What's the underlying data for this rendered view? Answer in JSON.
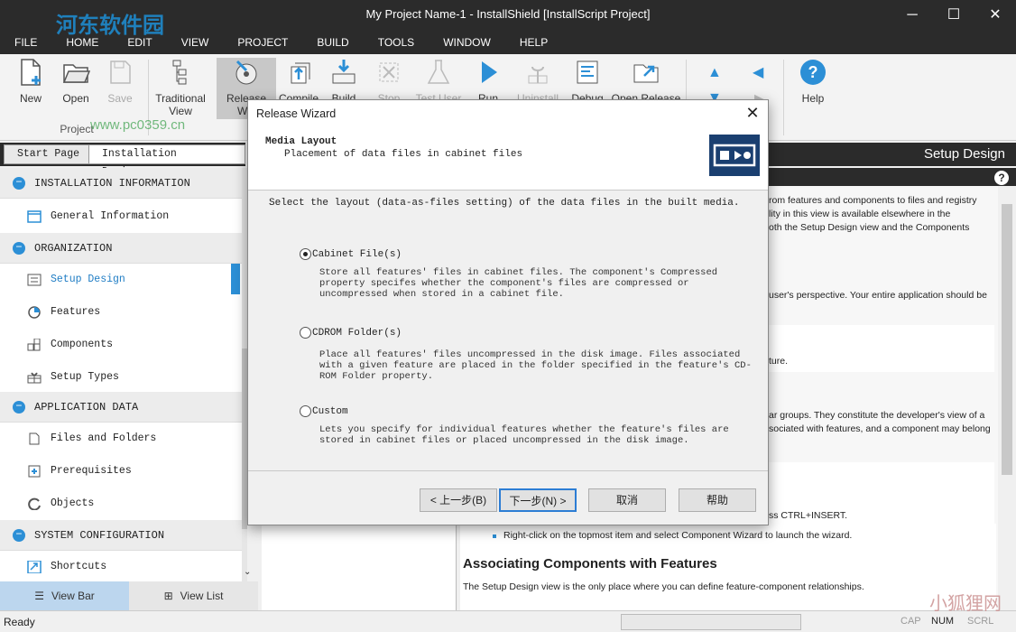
{
  "window": {
    "title": "My Project Name-1 - InstallShield [InstallScript Project]",
    "minimize": "─",
    "maximize": "☐",
    "close": "✕"
  },
  "watermark": {
    "site": "河东软件园",
    "url": "www.pc0359.cn",
    "site2": "小狐狸网",
    "url2": "XHLKS.CN"
  },
  "menu": [
    "FILE",
    "HOME",
    "EDIT",
    "VIEW",
    "PROJECT",
    "BUILD",
    "TOOLS",
    "WINDOW",
    "HELP"
  ],
  "ribbon": {
    "project": {
      "new": "New",
      "open": "Open",
      "save": "Save",
      "group": "Project"
    },
    "traditional": "Traditional View",
    "release": "Release Wiz",
    "compile": "Compile",
    "build": "Build",
    "stop": "Stop",
    "test_user": "Test User",
    "run": "Run",
    "uninstall": "Uninstall",
    "debug": "Debug",
    "open_release": "Open Release",
    "help": "Help"
  },
  "tabs": {
    "start": "Start Page",
    "designer": "Installation Designer"
  },
  "nav": {
    "sec1": "INSTALLATION INFORMATION",
    "general": "General Information",
    "sec2": "ORGANIZATION",
    "setup_design": "Setup Design",
    "features": "Features",
    "components": "Components",
    "setup_types": "Setup Types",
    "sec3": "APPLICATION DATA",
    "files": "Files and Folders",
    "prereq": "Prerequisites",
    "objects": "Objects",
    "sec4": "SYSTEM CONFIGURATION",
    "shortcuts": "Shortcuts"
  },
  "viewbar": {
    "viewbar": "View Bar",
    "viewlist": "View List"
  },
  "status": {
    "ready": "Ready",
    "cap": "CAP",
    "num": "NUM",
    "scrl": "SCRL"
  },
  "right": {
    "header": "Setup Design",
    "lines": [
      "rom features and components to files and registry",
      "lity in this view is available elsewhere in the",
      "oth the Setup Design view and the Components",
      "user's perspective. Your entire application should be",
      "ture.",
      "ar groups. They constitute the developer's view of a",
      "sociated with features, and a component may belong",
      "ss CTRL+INSERT.",
      "Right-click on the topmost item and select Component Wizard to launch the wizard."
    ],
    "heading": "Associating Components with Features",
    "para": "The Setup Design view is the only place where you can define feature-component relationships."
  },
  "dialog": {
    "title": "Release Wizard",
    "heading": "Media Layout",
    "subheading": "Placement of data files in cabinet files",
    "prompt": "Select the layout (data-as-files setting) of the data files in the built media.",
    "options": [
      {
        "label": "Cabinet File(s)",
        "desc": "Store all features' files in cabinet files. The component's Compressed property specifes whether the component's files are compressed or uncompressed when stored in a cabinet file.",
        "selected": true
      },
      {
        "label": "CDROM Folder(s)",
        "desc": "Place all features' files uncompressed in the disk image. Files associated with a given feature are placed in the folder specified in the feature's CD-ROM Folder property.",
        "selected": false
      },
      {
        "label": "Custom",
        "desc": "Lets you specify for individual features whether the feature's files are stored in cabinet files or placed uncompressed in the disk image.",
        "selected": false
      }
    ],
    "buttons": {
      "back": "< 上一步(B)",
      "next": "下一步(N) >",
      "cancel": "取消",
      "help": "帮助"
    }
  }
}
